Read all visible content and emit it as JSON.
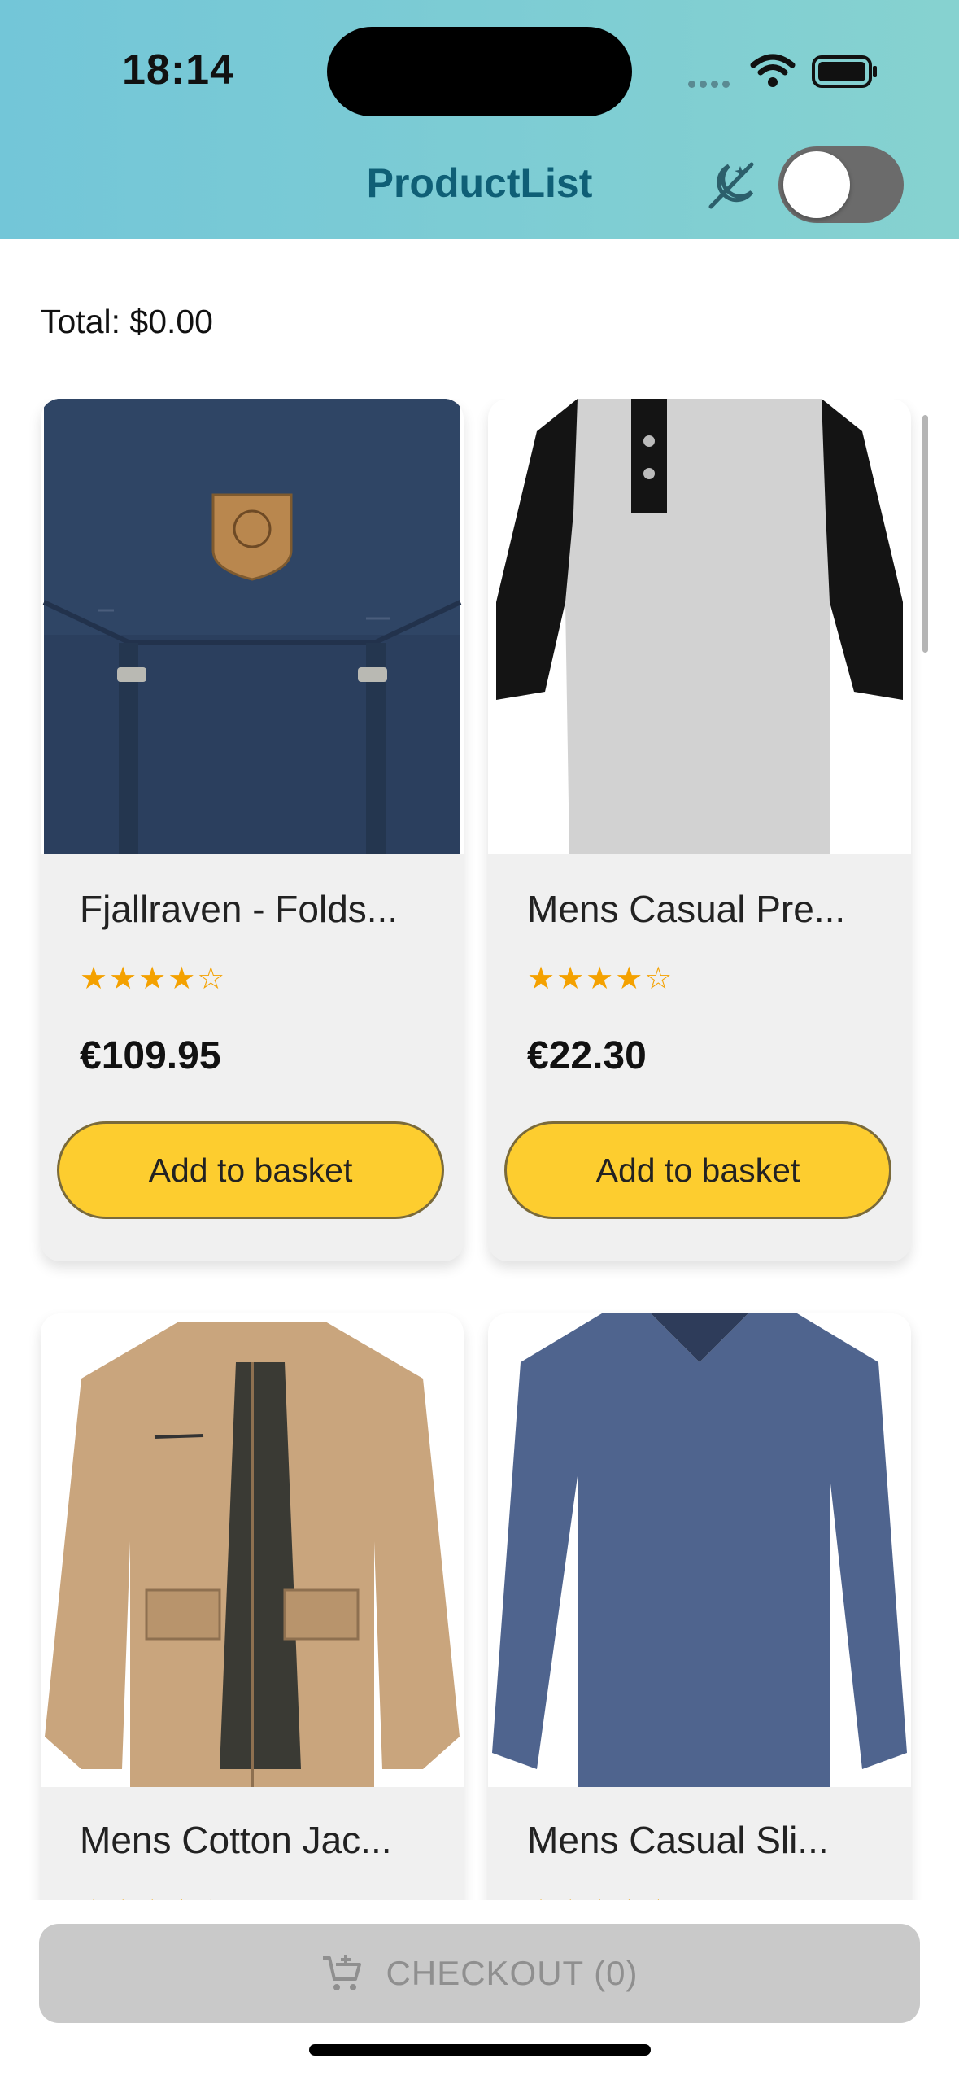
{
  "status_bar": {
    "time": "18:14"
  },
  "header": {
    "title": "ProductList",
    "theme_icon": "theme-mode-icon",
    "dark_mode_toggle": "off"
  },
  "summary": {
    "total_text": "Total: $0.00"
  },
  "products": [
    {
      "name": "Fjallraven - Folds...",
      "stars": "★★★★☆",
      "price": "€109.95",
      "button": "Add to basket"
    },
    {
      "name": "Mens Casual Pre...",
      "stars": "★★★★☆",
      "price": "€22.30",
      "button": "Add to basket"
    },
    {
      "name": "Mens Cotton Jac...",
      "stars": "★★★★★",
      "price": "",
      "button": ""
    },
    {
      "name": "Mens Casual Sli...",
      "stars": "★★★★★",
      "price": "",
      "button": ""
    }
  ],
  "checkout": {
    "label": "CHECKOUT (0)",
    "icon": "cart-icon"
  },
  "colors": {
    "header_start": "#73c6d8",
    "header_end": "#86d2d0",
    "title": "#0f5f76",
    "button": "#fdcd2f",
    "star": "#f4a100",
    "checkout_bg": "#c9c9c9"
  }
}
